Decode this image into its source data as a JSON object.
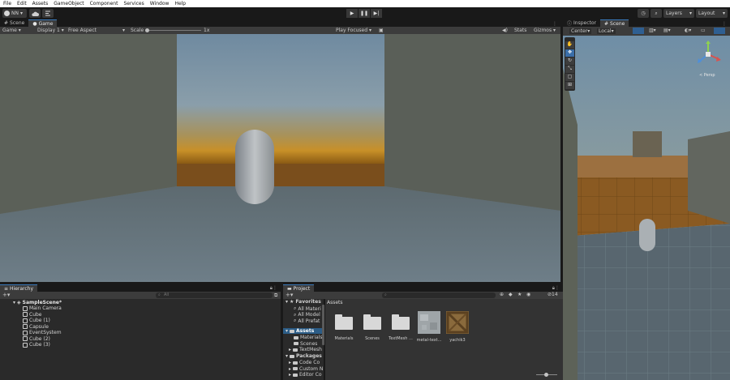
{
  "menu": [
    "File",
    "Edit",
    "Assets",
    "GameObject",
    "Component",
    "Services",
    "Window",
    "Help"
  ],
  "toolbar": {
    "account": "NN",
    "layers": "Layers",
    "layout": "Layout"
  },
  "game_tabs": [
    "Scene",
    "Game"
  ],
  "game_bar": {
    "view": "Game",
    "display": "Display 1",
    "aspect": "Free Aspect",
    "scale_label": "Scale",
    "scale_value": "1x",
    "play_mode": "Play Focused",
    "stats": "Stats",
    "gizmos": "Gizmos"
  },
  "right_tabs": [
    "Inspector",
    "Scene"
  ],
  "scene_bar": {
    "pivot": "Center",
    "space": "Local"
  },
  "scene_view": {
    "persp": "< Persp"
  },
  "hierarchy": {
    "tab": "Hierarchy",
    "search_placeholder": "All",
    "scene": "SampleScene*",
    "items": [
      "Main Camera",
      "Cube",
      "Cube (1)",
      "Capsule",
      "EventSystem",
      "Cube (2)",
      "Cube (3)"
    ]
  },
  "project": {
    "tab": "Project",
    "count": "14",
    "favorites": "Favorites",
    "favorite_items": [
      "All Materi",
      "All Model",
      "All Prefat"
    ],
    "assets_root": "Assets",
    "asset_folders": [
      "Materials",
      "Scenes",
      "TextMesh"
    ],
    "packages": "Packages",
    "package_items": [
      "Code Co",
      "Custom N",
      "Editor Co"
    ],
    "breadcrumb": "Assets",
    "grid": [
      {
        "label": "Materials",
        "kind": "folder"
      },
      {
        "label": "Scenes",
        "kind": "folder"
      },
      {
        "label": "TextMesh ...",
        "kind": "folder"
      },
      {
        "label": "metal-text...",
        "kind": "metal"
      },
      {
        "label": "yachik3",
        "kind": "crate"
      }
    ]
  },
  "colors": {
    "accent": "#3a79bb",
    "panel": "#3c3c3c",
    "background": "#191919"
  }
}
